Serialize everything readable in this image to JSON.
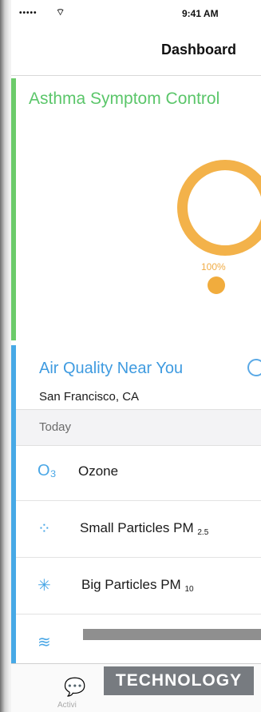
{
  "status_bar": {
    "signal": "•••••",
    "wifi": "⌔",
    "time": "9:41 AM"
  },
  "nav": {
    "title": "Dashboard"
  },
  "asthma_card": {
    "title": "Asthma Symptom Control",
    "percent_label": "100%",
    "control_level": 1.0,
    "accent_color": "#6ccb6a",
    "ring_color": "#f3b24a"
  },
  "air_quality": {
    "title": "Air Quality Near You",
    "location": "San Francisco, CA",
    "section_header": "Today",
    "accent_color": "#47a9e6",
    "items": [
      {
        "icon": "ozone-icon",
        "glyph": "O₃",
        "label": "Ozone",
        "sub": ""
      },
      {
        "icon": "small-particles-icon",
        "glyph": "⁘",
        "label": "Small Particles PM",
        "sub": "2.5"
      },
      {
        "icon": "big-particles-icon",
        "glyph": "✳",
        "label": "Big Particles PM",
        "sub": "10"
      },
      {
        "icon": "wind-icon",
        "glyph": "≋",
        "label": "",
        "sub": ""
      }
    ]
  },
  "tab_bar": {
    "tab_label": "Activi"
  },
  "overlay": {
    "badge_text": "TECHNOLOGY"
  }
}
